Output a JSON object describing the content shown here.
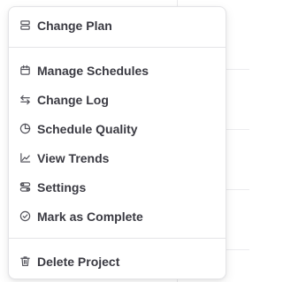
{
  "menu": {
    "items": [
      {
        "label": "Change Plan",
        "icon": "rows-icon"
      },
      {
        "label": "Manage Schedules",
        "icon": "calendar-icon"
      },
      {
        "label": "Change Log",
        "icon": "arrows-swap-icon"
      },
      {
        "label": "Schedule Quality",
        "icon": "pie-chart-icon"
      },
      {
        "label": "View Trends",
        "icon": "line-chart-icon"
      },
      {
        "label": "Settings",
        "icon": "toggles-icon"
      },
      {
        "label": "Mark as Complete",
        "icon": "check-circle-icon"
      },
      {
        "label": "Delete Project",
        "icon": "trash-icon"
      }
    ]
  },
  "colors": {
    "text": "#3a3a42",
    "icon": "#55555d",
    "border": "#e4e4e7"
  }
}
